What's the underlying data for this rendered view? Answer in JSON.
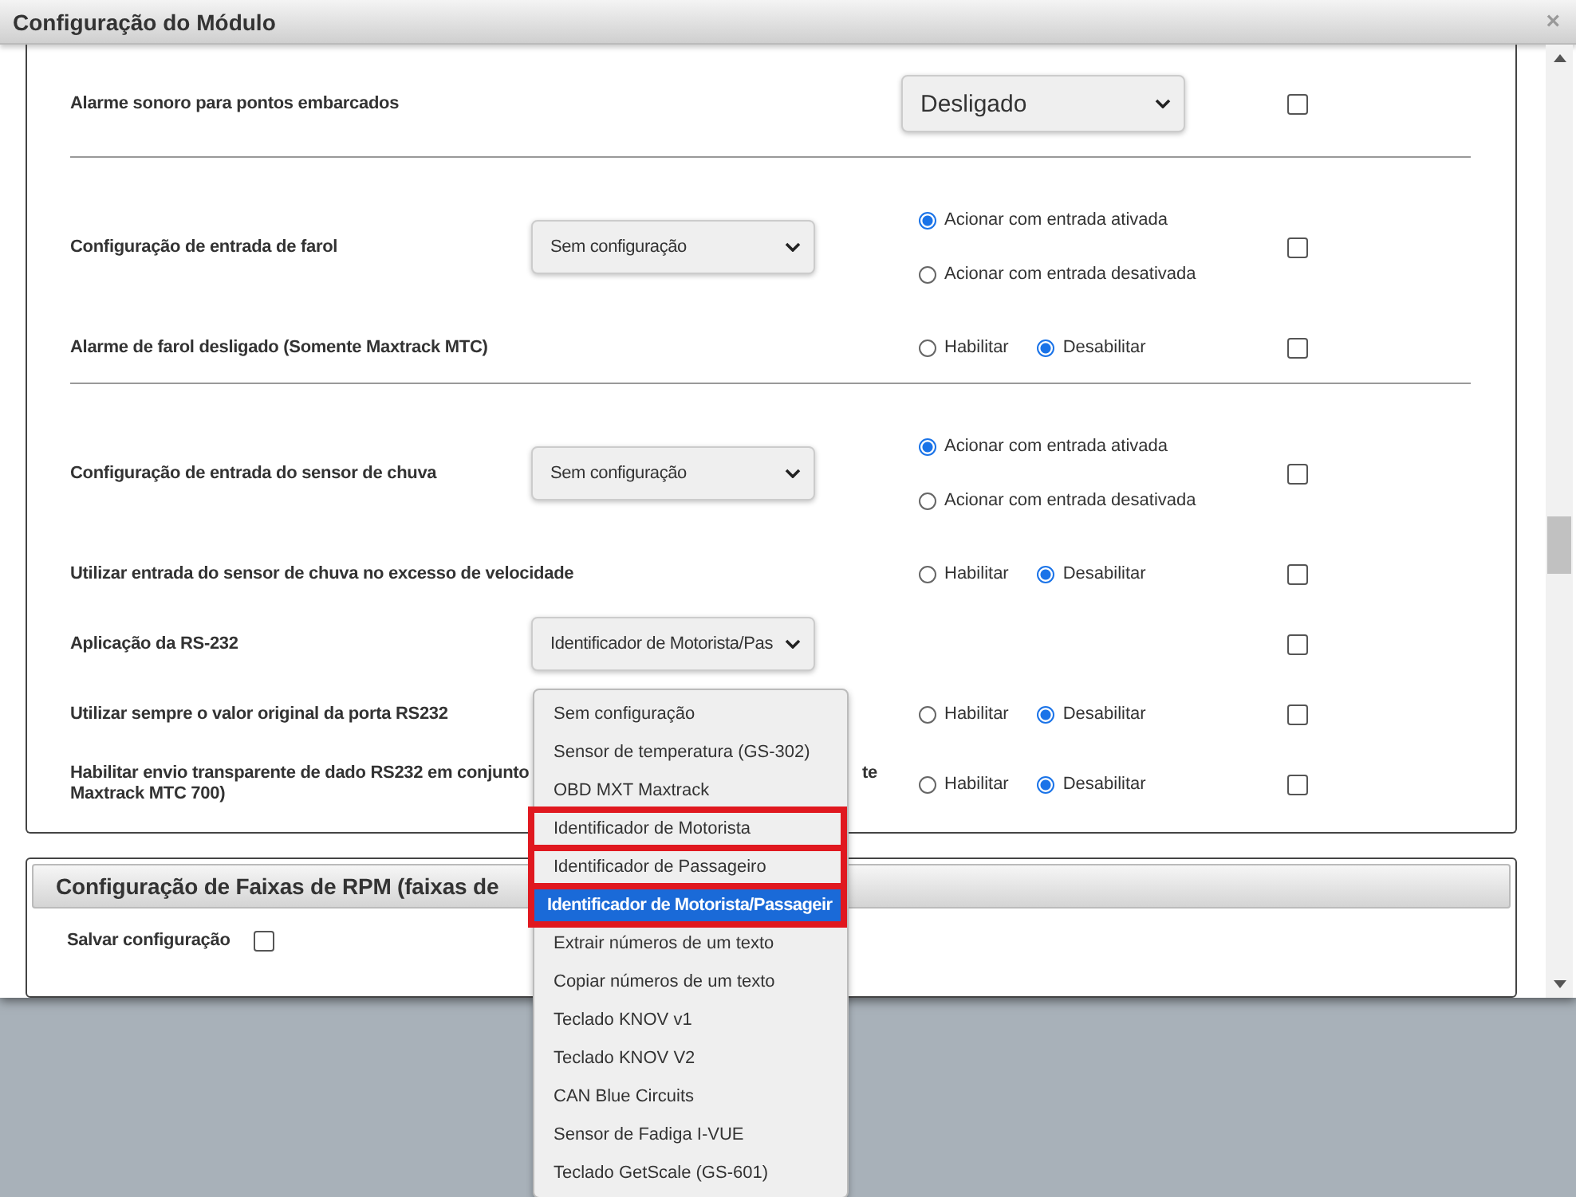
{
  "window": {
    "title": "Configuração do Módulo",
    "close": "×"
  },
  "rows": [
    {
      "kind": "wide-select",
      "label": "Alarme sonoro para pontos embarcados",
      "select": "Desligado",
      "checked": false
    },
    {
      "kind": "divider"
    },
    {
      "kind": "select-stacked",
      "label": "Configuração de entrada de farol",
      "select": "Sem configuração",
      "radios": [
        {
          "label": "Acionar com entrada ativada",
          "selected": true
        },
        {
          "label": "Acionar com entrada desativada",
          "selected": false
        }
      ],
      "checked": false
    },
    {
      "kind": "radios",
      "label": "Alarme de farol desligado (Somente Maxtrack MTC)",
      "radios": [
        {
          "label": "Habilitar",
          "selected": false
        },
        {
          "label": "Desabilitar",
          "selected": true
        }
      ],
      "checked": false
    },
    {
      "kind": "divider"
    },
    {
      "kind": "select-stacked",
      "label": "Configuração de entrada do sensor de chuva",
      "select": "Sem configuração",
      "radios": [
        {
          "label": "Acionar com entrada ativada",
          "selected": true
        },
        {
          "label": "Acionar com entrada desativada",
          "selected": false
        }
      ],
      "checked": false
    },
    {
      "kind": "radios",
      "label": "Utilizar entrada do sensor de chuva no excesso de velocidade",
      "radios": [
        {
          "label": "Habilitar",
          "selected": false
        },
        {
          "label": "Desabilitar",
          "selected": true
        }
      ],
      "checked": false
    },
    {
      "kind": "select",
      "label": "Aplicação da RS-232",
      "select": "Identificador de Motorista/Pas",
      "checked": false
    },
    {
      "kind": "radios",
      "label": "Utilizar sempre o valor original da porta RS232",
      "radios": [
        {
          "label": "Habilitar",
          "selected": false
        },
        {
          "label": "Desabilitar",
          "selected": true
        }
      ],
      "checked": false
    },
    {
      "kind": "covered",
      "label_parts": [
        "Habilitar envio transparente de dado RS232 em conjunto",
        "te",
        "Maxtrack MTC 700)"
      ],
      "radios": [
        {
          "label": "Habilitar",
          "selected": false
        },
        {
          "label": "Desabilitar",
          "selected": true
        }
      ],
      "checked": false
    }
  ],
  "rpm_section": {
    "title": "Configuração de Faixas de RPM (faixas de",
    "save_label": "Salvar configuração",
    "checked": false
  },
  "dropdown": [
    {
      "label": "Sem configuração",
      "selected": false,
      "highlighted": false
    },
    {
      "label": "Sensor de temperatura (GS-302)",
      "selected": false,
      "highlighted": false
    },
    {
      "label": "OBD MXT Maxtrack",
      "selected": false,
      "highlighted": false
    },
    {
      "label": "Identificador de Motorista",
      "selected": false,
      "highlighted": true
    },
    {
      "label": "Identificador de Passageiro",
      "selected": false,
      "highlighted": true
    },
    {
      "label": "Identificador de Motorista/Passageir",
      "selected": true,
      "highlighted": true
    },
    {
      "label": "Extrair números de um texto",
      "selected": false,
      "highlighted": false
    },
    {
      "label": "Copiar números de um texto",
      "selected": false,
      "highlighted": false
    },
    {
      "label": "Teclado KNOV v1",
      "selected": false,
      "highlighted": false
    },
    {
      "label": "Teclado KNOV V2",
      "selected": false,
      "highlighted": false
    },
    {
      "label": "CAN Blue Circuits",
      "selected": false,
      "highlighted": false
    },
    {
      "label": "Sensor de Fadiga I-VUE",
      "selected": false,
      "highlighted": false
    },
    {
      "label": "Teclado GetScale (GS-601)",
      "selected": false,
      "highlighted": false
    }
  ]
}
